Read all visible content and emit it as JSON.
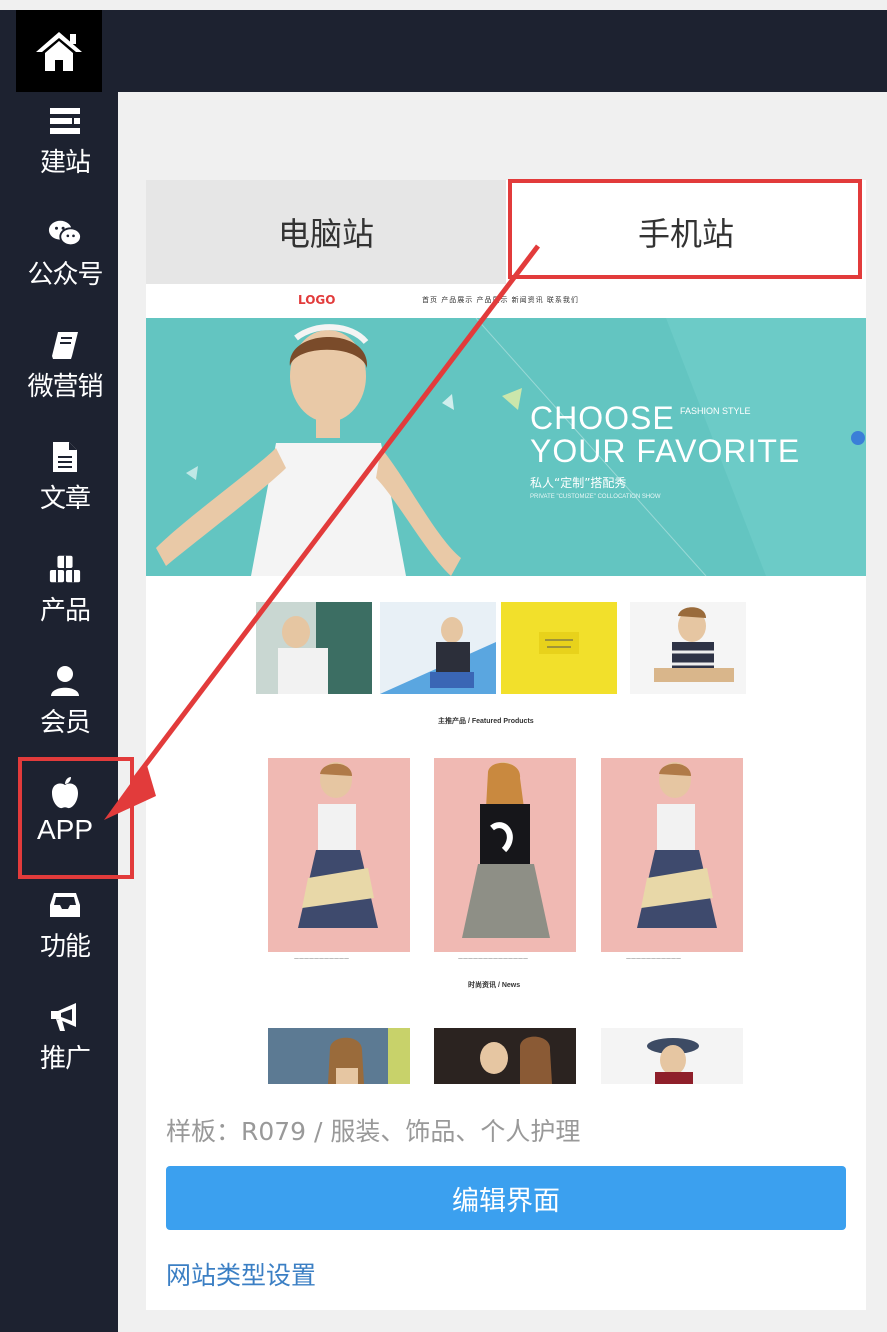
{
  "sidebar": {
    "items": [
      {
        "label": "建站",
        "icon": "site-builder-icon"
      },
      {
        "label": "公众号",
        "icon": "wechat-icon"
      },
      {
        "label": "微营销",
        "icon": "book-icon"
      },
      {
        "label": "文章",
        "icon": "document-icon"
      },
      {
        "label": "产品",
        "icon": "boxes-icon"
      },
      {
        "label": "会员",
        "icon": "user-icon"
      },
      {
        "label": "APP",
        "icon": "apple-icon"
      },
      {
        "label": "功能",
        "icon": "inbox-icon"
      },
      {
        "label": "推广",
        "icon": "megaphone-icon"
      }
    ],
    "home_icon": "home-icon"
  },
  "tabs": {
    "pc": "电脑站",
    "mobile": "手机站"
  },
  "preview": {
    "logo": "LOGO",
    "nav_links": "首页   产品展示   产品展示   新闻资讯   联系我们",
    "banner": {
      "line1": "CHOOSE",
      "fashion": "FASHION STYLE",
      "line2": "YOUR FAVORITE",
      "line3": "私人“定制”搭配秀",
      "line4": "PRIVATE \"CUSTOMIZE\" COLLOCATION SHOW"
    },
    "featured_title": "主推产品 / Featured Products",
    "news_title": "时尚资讯 / News"
  },
  "sample_text": "样板：R079 / 服装、饰品、个人护理",
  "edit_button": "编辑界面",
  "site_type_link": "网站类型设置",
  "colors": {
    "sidebar": "#1d2230",
    "accent": "#3ba0ef",
    "highlight": "#e23b3b",
    "banner": "#63c5c1"
  }
}
